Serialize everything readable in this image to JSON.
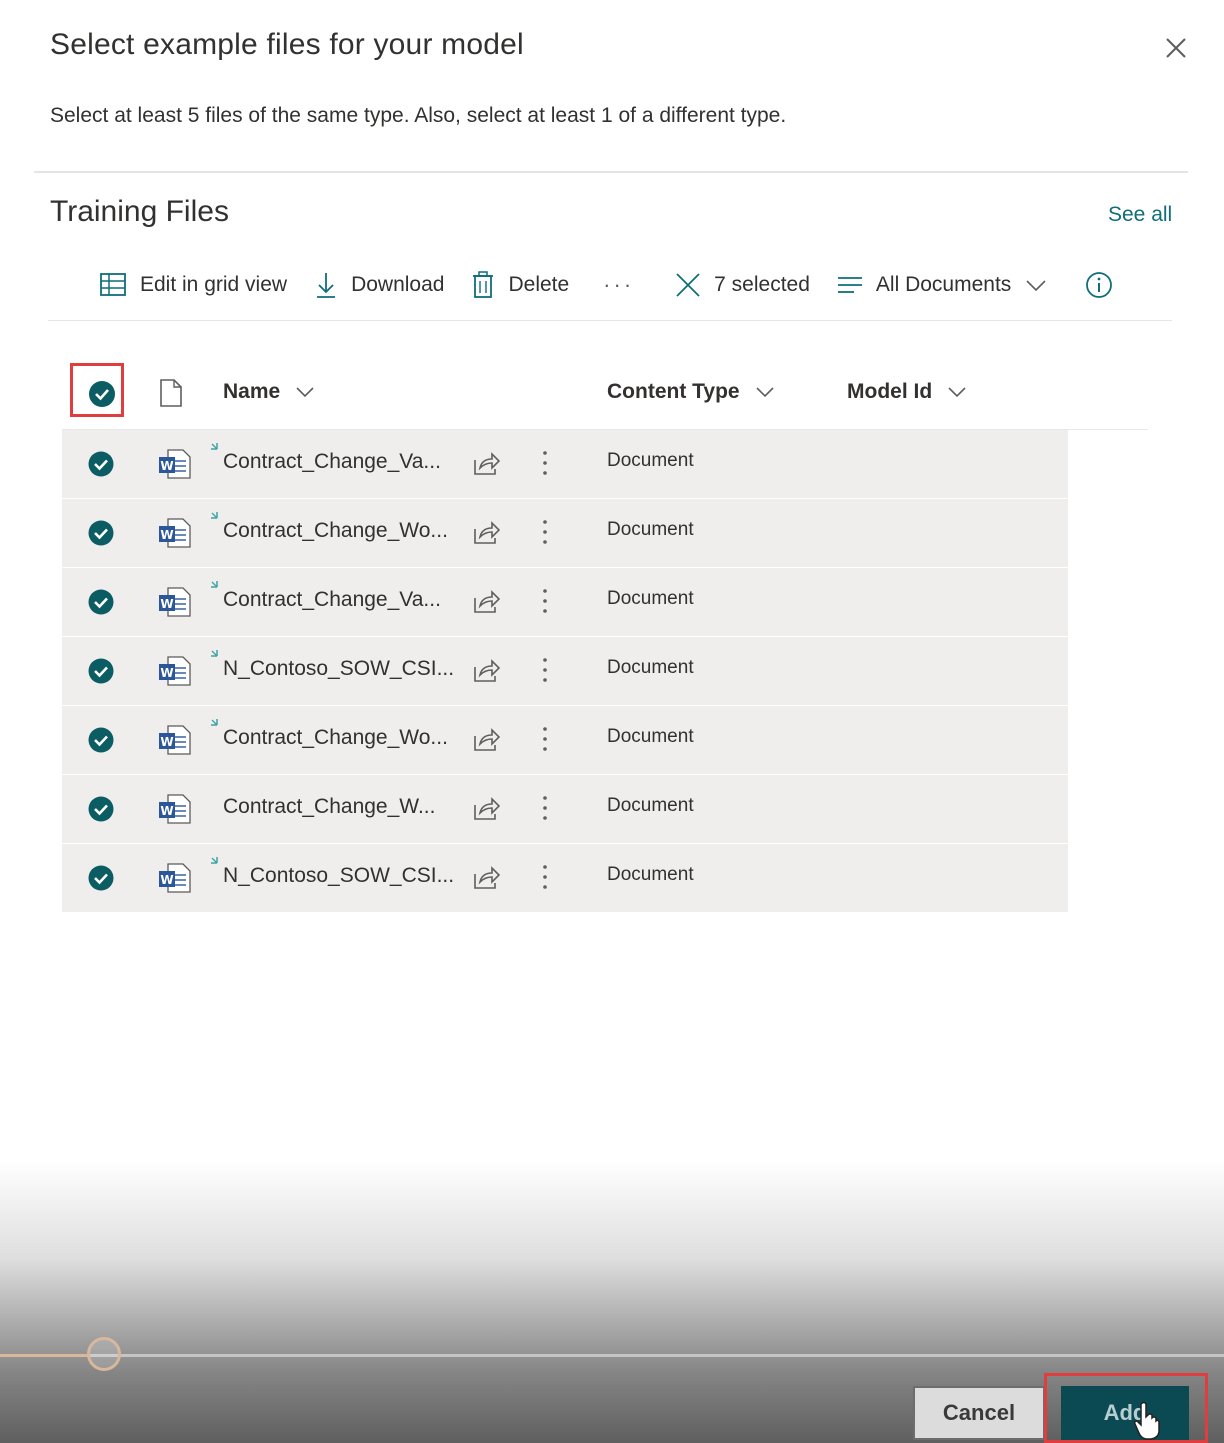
{
  "dialog": {
    "title": "Select example files for your model",
    "subtitle": "Select at least 5 files of the same type. Also, select at least 1 of a different type."
  },
  "section": {
    "title": "Training Files",
    "see_all": "See all"
  },
  "toolbar": {
    "edit_grid": "Edit in grid view",
    "download": "Download",
    "delete": "Delete",
    "more": "···",
    "selected": "7 selected",
    "view": "All Documents"
  },
  "columns": {
    "name": "Name",
    "content_type": "Content Type",
    "model_id": "Model Id"
  },
  "files": [
    {
      "name": "Contract_Change_Va...",
      "content_type": "Document",
      "new": true
    },
    {
      "name": "Contract_Change_Wo...",
      "content_type": "Document",
      "new": true
    },
    {
      "name": "Contract_Change_Va...",
      "content_type": "Document",
      "new": true
    },
    {
      "name": "N_Contoso_SOW_CSI...",
      "content_type": "Document",
      "new": true
    },
    {
      "name": "Contract_Change_Wo...",
      "content_type": "Document",
      "new": true
    },
    {
      "name": "Contract_Change_W...",
      "content_type": "Document",
      "new": false
    },
    {
      "name": "N_Contoso_SOW_CSI...",
      "content_type": "Document",
      "new": true
    }
  ],
  "footer": {
    "cancel": "Cancel",
    "add": "Add"
  },
  "colors": {
    "accent": "#0b5c63",
    "highlight": "#e03e3e",
    "word": "#2b579a"
  }
}
